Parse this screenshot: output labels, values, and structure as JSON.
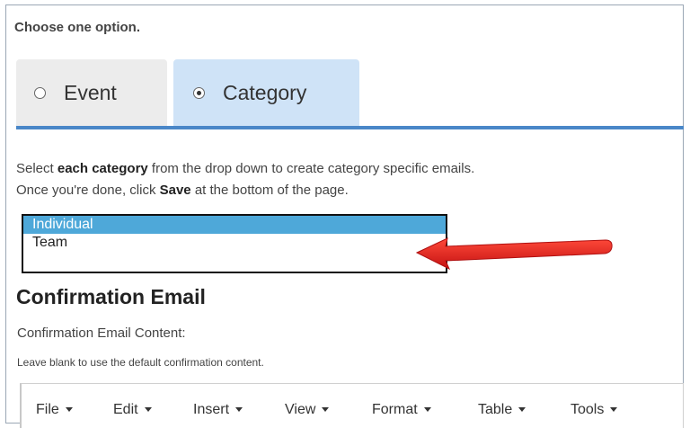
{
  "instruction": "Choose one option.",
  "tabs": [
    {
      "label": "Event",
      "selected": false
    },
    {
      "label": "Category",
      "selected": true
    }
  ],
  "description": {
    "line1_pre": "Select ",
    "line1_bold": "each category",
    "line1_post": " from the drop down to create category specific emails.",
    "line2_pre": "Once you're done, click ",
    "line2_bold": "Save",
    "line2_post": " at the bottom of the page."
  },
  "category_list": {
    "options": [
      "Individual",
      "Team"
    ],
    "selected": "Individual"
  },
  "section": {
    "title": "Confirmation Email",
    "field_label": "Confirmation Email Content:",
    "hint": "Leave blank to use the default confirmation content."
  },
  "editor_menu": [
    "File",
    "Edit",
    "Insert",
    "View",
    "Format",
    "Table",
    "Tools"
  ],
  "colors": {
    "selected_tab": "#cfe3f7",
    "tab_rule": "#4a87c8",
    "selected_option": "#4ea8d9",
    "arrow": "#e02020"
  }
}
